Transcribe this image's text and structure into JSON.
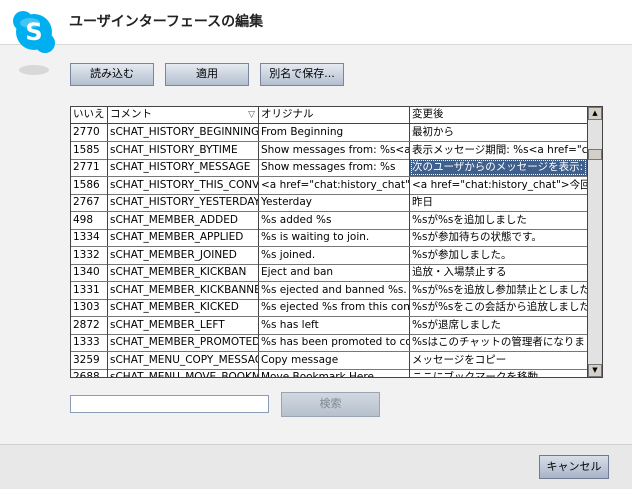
{
  "header": {
    "title": "ユーザインターフェースの編集",
    "brand_color": "#00aff0"
  },
  "toolbar": {
    "load_label": "読み込む",
    "apply_label": "適用",
    "save_as_label": "別名で保存..."
  },
  "table": {
    "columns": [
      "いいえ",
      "コメント",
      "オリジナル",
      "変更後"
    ],
    "selected_row": 2,
    "rows": [
      {
        "no": "2770",
        "comment": "sCHAT_HISTORY_BEGINNING",
        "original": "From Beginning",
        "changed": "最初から"
      },
      {
        "no": "1585",
        "comment": "sCHAT_HISTORY_BYTIME",
        "original": "Show messages from: %s<a h",
        "changed": "表示メッセージ期間: %s<a href=\"ch"
      },
      {
        "no": "2771",
        "comment": "sCHAT_HISTORY_MESSAGE",
        "original": "Show messages from: %s",
        "changed": "次のユーザからのメッセージを表示: %"
      },
      {
        "no": "1586",
        "comment": "sCHAT_HISTORY_THIS_CONVE",
        "original": "<a href=\"chat:history_chat\">",
        "changed": "<a href=\"chat:history_chat\">今回の"
      },
      {
        "no": "2767",
        "comment": "sCHAT_HISTORY_YESTERDAY",
        "original": "Yesterday",
        "changed": "昨日"
      },
      {
        "no": "498",
        "comment": "sCHAT_MEMBER_ADDED",
        "original": "%s added %s",
        "changed": "%sが%sを追加しました"
      },
      {
        "no": "1334",
        "comment": "sCHAT_MEMBER_APPLIED",
        "original": "%s is waiting to join.",
        "changed": "%sが参加待ちの状態です。"
      },
      {
        "no": "1332",
        "comment": "sCHAT_MEMBER_JOINED",
        "original": "%s joined.",
        "changed": "%sが参加しました。"
      },
      {
        "no": "1340",
        "comment": "sCHAT_MEMBER_KICKBAN",
        "original": "Eject and ban",
        "changed": "追放・入場禁止する"
      },
      {
        "no": "1331",
        "comment": "sCHAT_MEMBER_KICKBANNED",
        "original": "%s ejected and banned %s.",
        "changed": "%sが%sを追放し参加禁止としました"
      },
      {
        "no": "1303",
        "comment": "sCHAT_MEMBER_KICKED",
        "original": "%s ejected %s from this conve",
        "changed": "%sが%sをこの会話から追放しました"
      },
      {
        "no": "2872",
        "comment": "sCHAT_MEMBER_LEFT",
        "original": "%s has left",
        "changed": "%sが退席しました"
      },
      {
        "no": "1333",
        "comment": "sCHAT_MEMBER_PROMOTED_",
        "original": "%s has been promoted to con",
        "changed": "%sはこのチャットの管理者になりました"
      },
      {
        "no": "3259",
        "comment": "sCHAT_MENU_COPY_MESSAGE",
        "original": "Copy message",
        "changed": "メッセージをコピー"
      },
      {
        "no": "2688",
        "comment": "sCHAT_MENU_MOVE_BOOKMA",
        "original": "Move Bookmark Here",
        "changed": "ここにブックマークを移動"
      }
    ]
  },
  "search": {
    "value": "",
    "placeholder": "",
    "button_label": "検索"
  },
  "footer": {
    "cancel_label": "キャンセル"
  }
}
